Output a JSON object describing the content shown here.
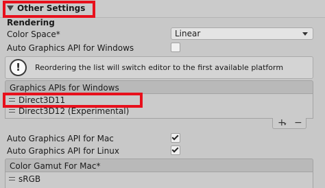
{
  "foldout": {
    "title": "Other Settings"
  },
  "rendering": {
    "title": "Rendering",
    "color_space": {
      "label": "Color Space*",
      "value": "Linear"
    },
    "auto_graphics_windows": {
      "label": "Auto Graphics API  for Windows",
      "checked": false
    }
  },
  "help": {
    "icon": "info-icon",
    "text": "Reordering the list will switch editor to the first available platform"
  },
  "graphics_apis_windows": {
    "header": "Graphics APIs for Windows",
    "items": [
      {
        "label": "Direct3D11"
      },
      {
        "label": "Direct3D12 (Experimental)"
      }
    ],
    "add_label": "+",
    "add_dropdown_label": "▾",
    "remove_label": "−"
  },
  "auto_graphics_mac": {
    "label": "Auto Graphics API  for Mac",
    "checked": true
  },
  "auto_graphics_linux": {
    "label": "Auto Graphics API  for Linux",
    "checked": true
  },
  "color_gamut_mac": {
    "header": "Color Gamut For Mac*",
    "items": [
      {
        "label": "sRGB"
      }
    ]
  },
  "highlight_color": "#e8101c"
}
